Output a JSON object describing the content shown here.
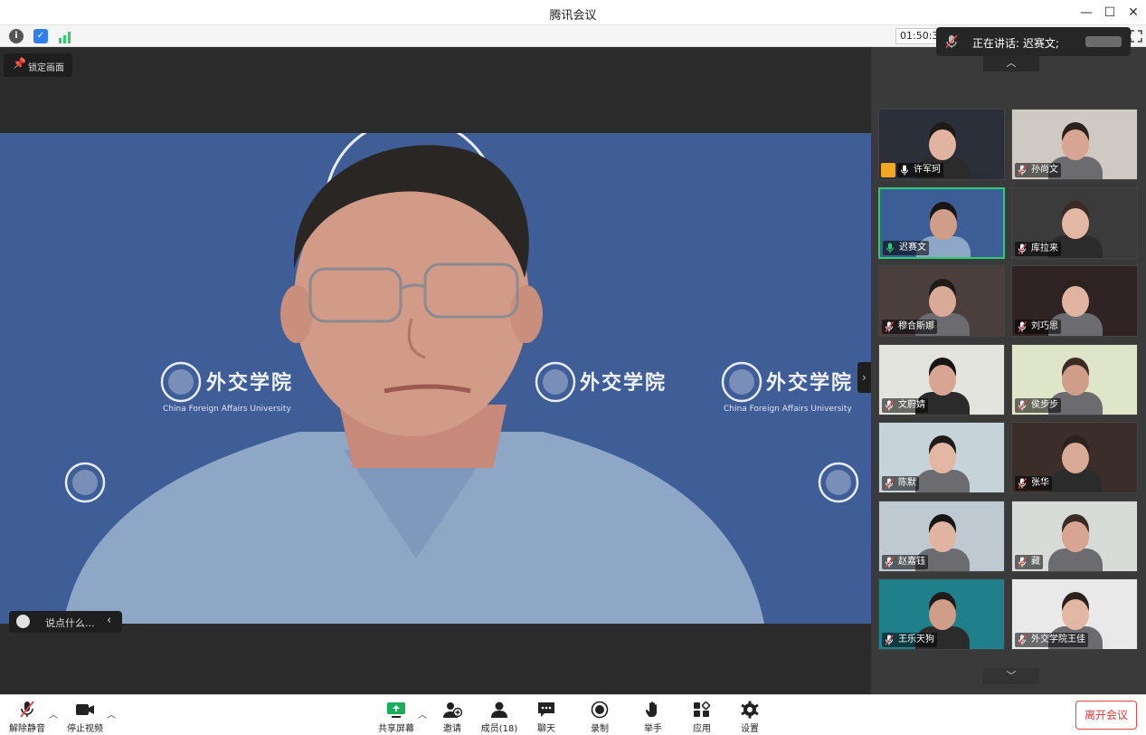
{
  "window": {
    "title": "腾讯会议"
  },
  "status": {
    "timer": "01:50:3",
    "speaking_text": "正在讲话: 迟赛文;"
  },
  "main": {
    "lock_label": "锁定画面",
    "say_placeholder": "说点什么...",
    "backdrop_brand": "外交学院",
    "backdrop_brand_en": "China Foreign Affairs University"
  },
  "participants": [
    {
      "name": "许军珂",
      "mic": "on"
    },
    {
      "name": "孙尚文",
      "mic": "muted"
    },
    {
      "name": "迟赛文",
      "mic": "on",
      "active": true
    },
    {
      "name": "库拉来",
      "mic": "muted"
    },
    {
      "name": "穆合斯娜",
      "mic": "muted"
    },
    {
      "name": "刘巧思",
      "mic": "muted"
    },
    {
      "name": "文蔚婧",
      "mic": "muted"
    },
    {
      "name": "侯步步",
      "mic": "muted"
    },
    {
      "name": "陈默",
      "mic": "muted"
    },
    {
      "name": "张华",
      "mic": "muted"
    },
    {
      "name": "赵嘉钰",
      "mic": "muted"
    },
    {
      "name": "藏",
      "mic": "muted"
    },
    {
      "name": "王乐天狗",
      "mic": "muted"
    },
    {
      "name": "外交学院王佳",
      "mic": "muted"
    }
  ],
  "toolbar": {
    "unmute": "解除静音",
    "stop_video": "停止视频",
    "share": "共享屏幕",
    "invite": "邀请",
    "members": "成员(18)",
    "chat": "聊天",
    "record": "录制",
    "raise_hand": "举手",
    "apps": "应用",
    "settings": "设置",
    "leave": "离开会议"
  },
  "colors": {
    "accent_green": "#2ecc71",
    "leave_red": "#e23a3f",
    "mute_red": "#e5484d"
  }
}
